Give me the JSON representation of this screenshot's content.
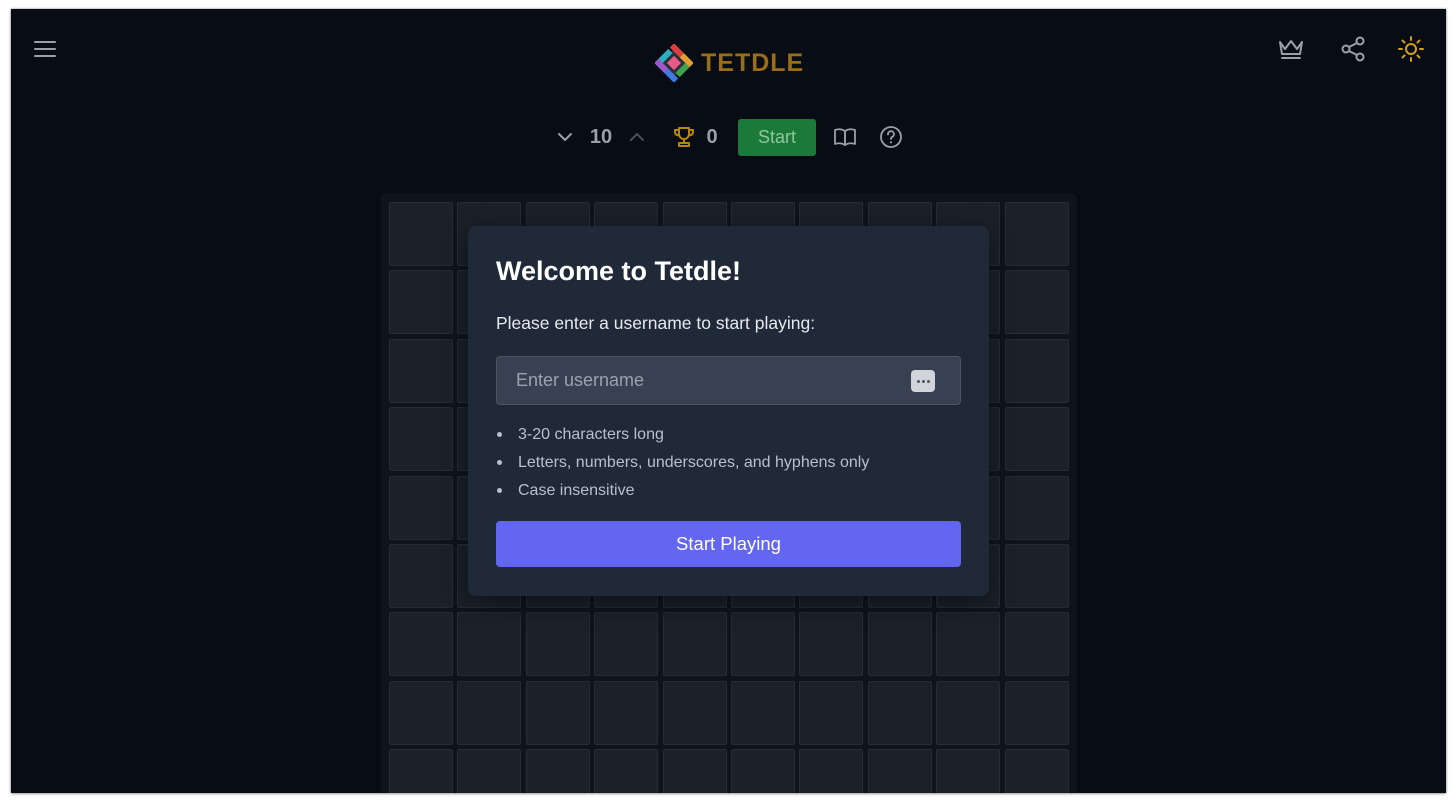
{
  "header": {
    "title": "TETDLE",
    "icons": [
      "menu-icon",
      "crown-icon",
      "share-icon",
      "sun-icon"
    ],
    "title_color": "#9a6d18"
  },
  "controls": {
    "level": "10",
    "score": "0",
    "start_label": "Start",
    "start_color": "#1b7a3a",
    "trophy_color": "#b8860b"
  },
  "board": {
    "columns": 10,
    "rows_visible": 9
  },
  "modal": {
    "title": "Welcome to Tetdle!",
    "subtitle": "Please enter a username to start playing:",
    "input_value": "",
    "input_placeholder": "Enter username",
    "rules": [
      "3-20 characters long",
      "Letters, numbers, underscores, and hyphens only",
      "Case insensitive"
    ],
    "button_label": "Start Playing",
    "button_color": "#6366f1"
  }
}
